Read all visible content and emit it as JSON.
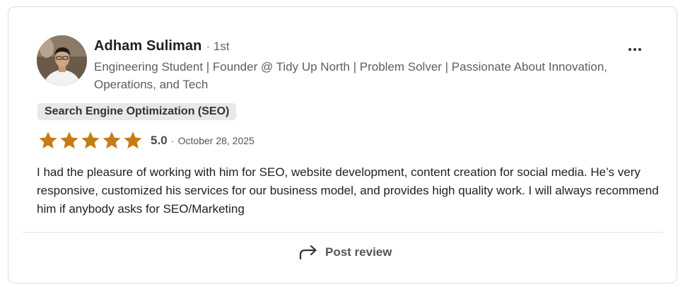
{
  "reviewer": {
    "name": "Adham Suliman",
    "degree": "· 1st",
    "headline": "Engineering Student | Founder @ Tidy Up North | Problem Solver | Passionate About Innovation, Operations, and Tech"
  },
  "skill_tag": "Search Engine Optimization (SEO)",
  "rating": {
    "stars": 5,
    "max_stars": 5,
    "score": "5.0",
    "separator": "·",
    "date": "October 28, 2025",
    "star_color": "#c37d16"
  },
  "review_text": "I had the pleasure of working with him for SEO, website development, content creation for social media. He’s very responsive, customized his services for our business model, and provides high quality work. I will always recommend him if anybody asks for SEO/Marketing",
  "actions": {
    "more_icon": "more-horizontal-icon",
    "post_review_label": "Post review",
    "post_review_icon": "share-arrow-icon"
  }
}
